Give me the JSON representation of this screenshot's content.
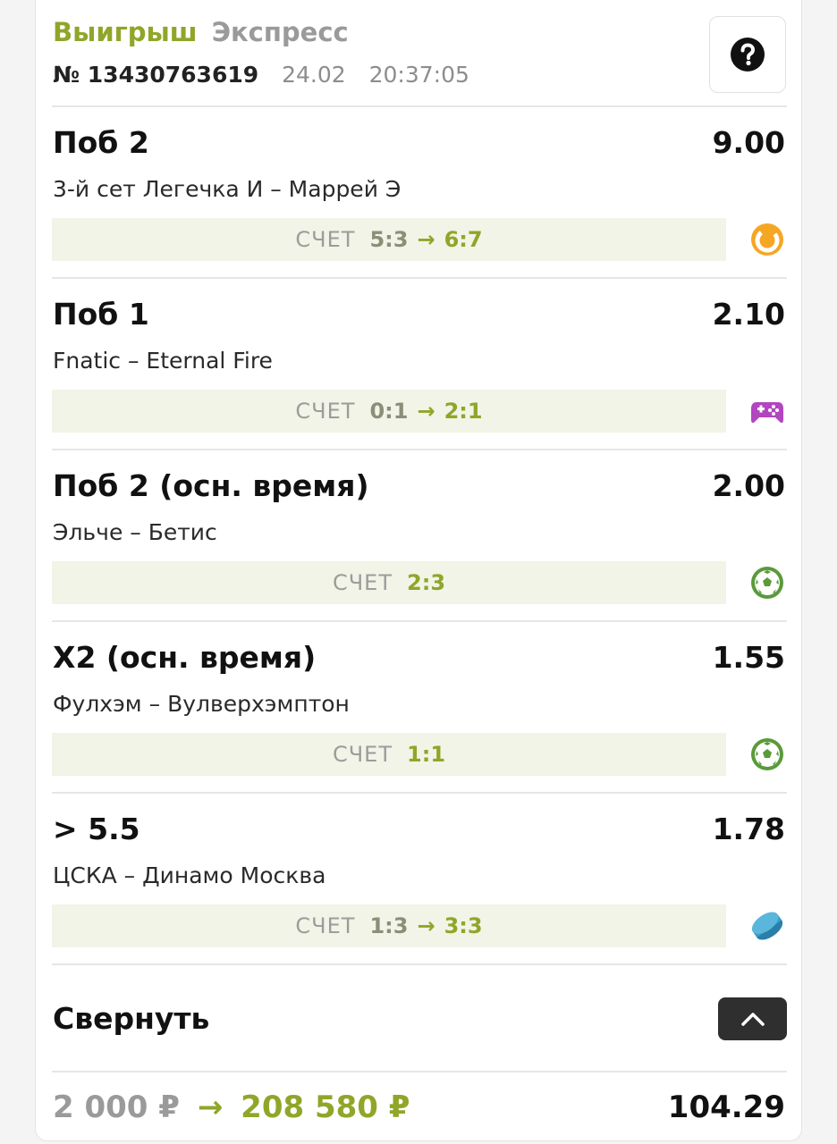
{
  "header": {
    "status": "Выигрыш",
    "bet_type": "Экспресс",
    "ticket_number": "№ 13430763619",
    "date": "24.02",
    "time": "20:37:05",
    "help_icon": "question-circle-icon"
  },
  "score_label": "СЧЕТ",
  "arrow": "→",
  "events": [
    {
      "market": "Поб 2",
      "odds": "9.00",
      "match": "3-й сет Легечка И – Маррей Э",
      "score_from": "5:3",
      "score_to": "6:7",
      "sport_icon": "tennis-icon",
      "icon_color": "#f5a623"
    },
    {
      "market": "Поб 1",
      "odds": "2.10",
      "match": "Fnatic – Eternal Fire",
      "score_from": "0:1",
      "score_to": "2:1",
      "sport_icon": "esports-gamepad-icon",
      "icon_color": "#b245c0"
    },
    {
      "market": "Поб 2 (осн. время)",
      "odds": "2.00",
      "match": "Эльче – Бетис",
      "score_to": "2:3",
      "sport_icon": "football-icon",
      "icon_color": "#5a9a3a"
    },
    {
      "market": "Х2 (осн. время)",
      "odds": "1.55",
      "match": "Фулхэм – Вулверхэмптон",
      "score_to": "1:1",
      "sport_icon": "football-icon",
      "icon_color": "#5a9a3a"
    },
    {
      "market": "> 5.5",
      "odds": "1.78",
      "match": "ЦСКА – Динамо Москва",
      "score_from": "1:3",
      "score_to": "3:3",
      "sport_icon": "hockey-puck-icon",
      "icon_color": "#3a9cc8"
    }
  ],
  "collapse": {
    "label": "Свернуть",
    "icon": "chevron-up-icon"
  },
  "footer": {
    "stake": "2 000 ₽",
    "arrow": "→",
    "payout": "208 580 ₽",
    "total_odds": "104.29"
  },
  "colors": {
    "accent": "#8fa629",
    "muted": "#9a9a9a",
    "score_bg": "#f1f4e6"
  }
}
